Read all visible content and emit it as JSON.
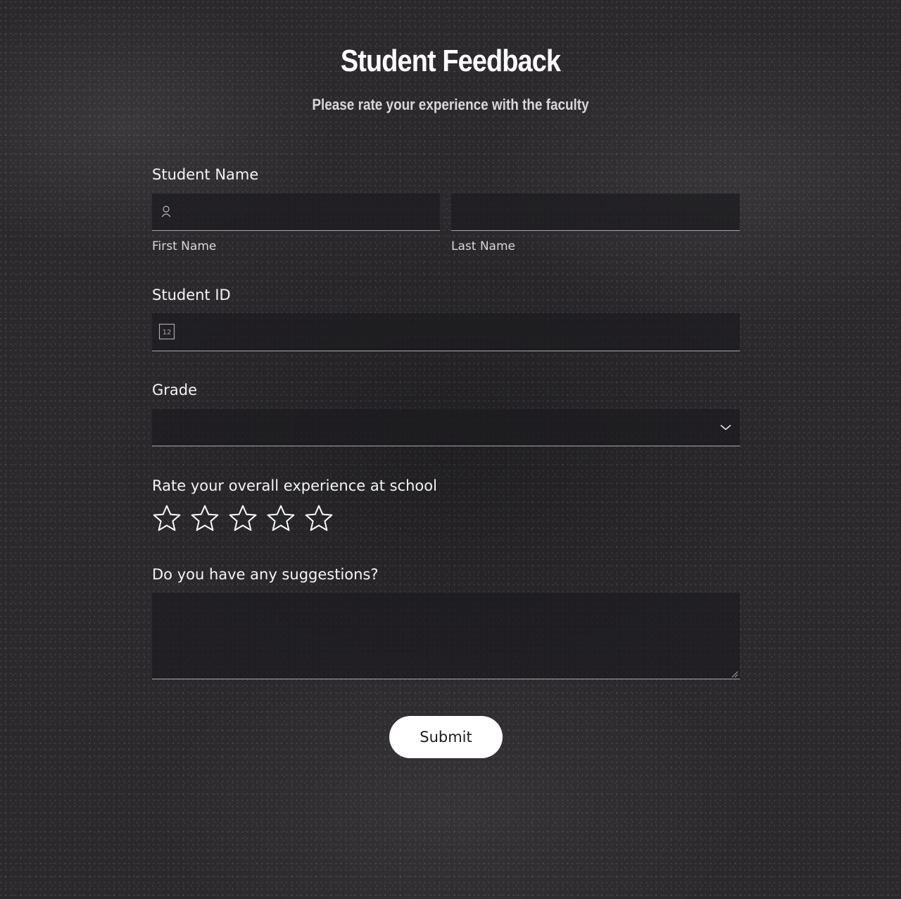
{
  "header": {
    "title": "Student Feedback",
    "subtitle": "Please rate your experience with the faculty"
  },
  "form": {
    "student_name": {
      "label": "Student Name",
      "first_name_label": "First Name",
      "first_name_value": "",
      "last_name_label": "Last Name",
      "last_name_value": "",
      "icon": "person-icon"
    },
    "student_id": {
      "label": "Student ID",
      "value": "",
      "icon": "number-icon",
      "icon_text": "12"
    },
    "grade": {
      "label": "Grade",
      "selected": "",
      "icon": "chevron-down-icon"
    },
    "rating": {
      "label": "Rate your overall experience at school",
      "max": 5,
      "value": 0,
      "icon": "star-outline-icon"
    },
    "suggestions": {
      "label": "Do you have any suggestions?",
      "value": ""
    },
    "submit_label": "Submit"
  },
  "colors": {
    "background": "#2b292c",
    "field": "#1c1a1e",
    "text": "#f4f4f4",
    "button": "#ffffff"
  }
}
